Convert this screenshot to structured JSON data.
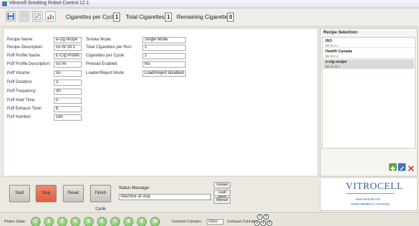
{
  "window": {
    "title": "Vitrocell Smoking Robot Control 12.1"
  },
  "toolbar": {
    "cigs_per_cycle_label": "Cigarettes per Cycle:",
    "cigs_per_cycle_value": "1",
    "total_cigs_label": "Total Cigarettes:",
    "total_cigs_value": "1",
    "remaining_cigs_label": "Remaining Cigarettes:",
    "remaining_cigs_value": "0"
  },
  "recipe_form": {
    "left": [
      {
        "label": "Recipe Name:",
        "value": "e-cig recipe"
      },
      {
        "label": "Recipe Description:",
        "value": "55 ml 30 s"
      },
      {
        "label": "Puff Profile Name:",
        "value": "E-Cig Profile"
      },
      {
        "label": "Puff Profile Description:",
        "value": "55 ml"
      },
      {
        "label": "Puff Volume:",
        "value": "55"
      },
      {
        "label": "Puff Duration:",
        "value": "3"
      },
      {
        "label": "Puff Frequency:",
        "value": "30"
      },
      {
        "label": "Puff Hold Time:",
        "value": "0"
      },
      {
        "label": "Puff Exhaust Time:",
        "value": "8"
      },
      {
        "label": "Puff Number:",
        "value": "180"
      }
    ],
    "right": [
      {
        "label": "Smoke Mode:",
        "value": "Single Mode"
      },
      {
        "label": "Total Cigarettes per Run:",
        "value": "1"
      },
      {
        "label": "Cigarettes per Cycle:",
        "value": "1"
      },
      {
        "label": "Preload Enabled:",
        "value": "No"
      },
      {
        "label": "Loader/Reject Mode:",
        "value": "Load/Reject disabled"
      }
    ]
  },
  "recipe_selection": {
    "heading": "Recipe Selection:",
    "items": [
      {
        "name": "ISO",
        "desc": "35 ml 2 s",
        "selected": false
      },
      {
        "name": "Health Canada",
        "desc": "55 ml 2 s",
        "selected": false
      },
      {
        "name": "e-cig recipe",
        "desc": "55 ml 30 s",
        "selected": true
      }
    ]
  },
  "controls": {
    "start": "Start",
    "stop": "Stop",
    "reset": "Reset",
    "finish_cycle": "Finish Cycle",
    "status_label": "Status Message:",
    "status_value": "Machine at stop",
    "unload": "Unload",
    "load_next": "Load Next",
    "manual": "Manual"
  },
  "logo": {
    "brand": "VITROCELL",
    "url": "www.vitrocell.com",
    "address": "79183 Waldkirch / Germany"
  },
  "statusbar": {
    "piston_state_label": "Piston State:",
    "pistons": [
      "1",
      "2",
      "3",
      "4",
      "5",
      "6",
      "7",
      "8",
      "9",
      "10"
    ],
    "inserted_cylinder_label": "Inserted Cylinder:",
    "inserted_cylinder_value": "100ml",
    "exhaust_cylinder_label": "Exhaust Cylinder:",
    "exhaust_top": [
      "1",
      "2"
    ],
    "exhaust_bottom": [
      "3",
      "4",
      "5"
    ]
  },
  "colors": {
    "stop_button": "#e05f3e",
    "piston_active": "#7cc463",
    "brand_blue": "#2f5fa8"
  },
  "icons": [
    "save-icon",
    "open-icon",
    "edit-icon",
    "chart-icon",
    "add-icon",
    "edit-recipe-icon",
    "delete-icon"
  ]
}
